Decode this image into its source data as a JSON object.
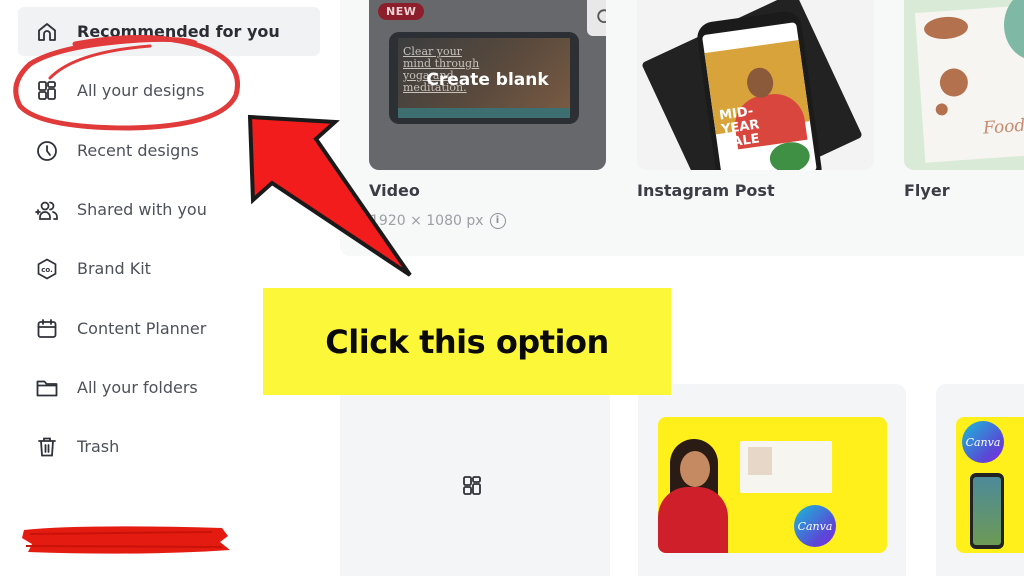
{
  "sidebar": {
    "items": [
      {
        "label": "Recommended for you",
        "icon": "home-icon",
        "active": true
      },
      {
        "label": "All your designs",
        "icon": "grid-icon",
        "active": false
      },
      {
        "label": "Recent designs",
        "icon": "clock-icon",
        "active": false
      },
      {
        "label": "Shared with you",
        "icon": "shared-users-icon",
        "active": false
      },
      {
        "label": "Brand Kit",
        "icon": "brand-kit-icon",
        "active": false
      },
      {
        "label": "Content Planner",
        "icon": "calendar-icon",
        "active": false
      },
      {
        "label": "All your folders",
        "icon": "folder-icon",
        "active": false
      },
      {
        "label": "Trash",
        "icon": "trash-icon",
        "active": false
      }
    ]
  },
  "design_types": [
    {
      "title": "Video",
      "subtitle": "1920 × 1080 px",
      "badge": "NEW",
      "hover_label": "Create blank",
      "preview_text": "Clear your mind through yoga and meditation."
    },
    {
      "title": "Instagram Post",
      "preview_text": "MID-YEAR SALE"
    },
    {
      "title": "Flyer",
      "preview_text": "Food"
    }
  ],
  "recent_designs": {
    "thumbnails": [
      {
        "brand_badge": "Canva"
      },
      {
        "brand_badge": "Canva"
      }
    ]
  },
  "annotation": {
    "callout_text": "Click this option",
    "highlighted_item": "All your designs",
    "colors": {
      "callout_bg": "#fdf73a",
      "arrow": "#f31c1c",
      "circle": "#e03a3a"
    }
  }
}
